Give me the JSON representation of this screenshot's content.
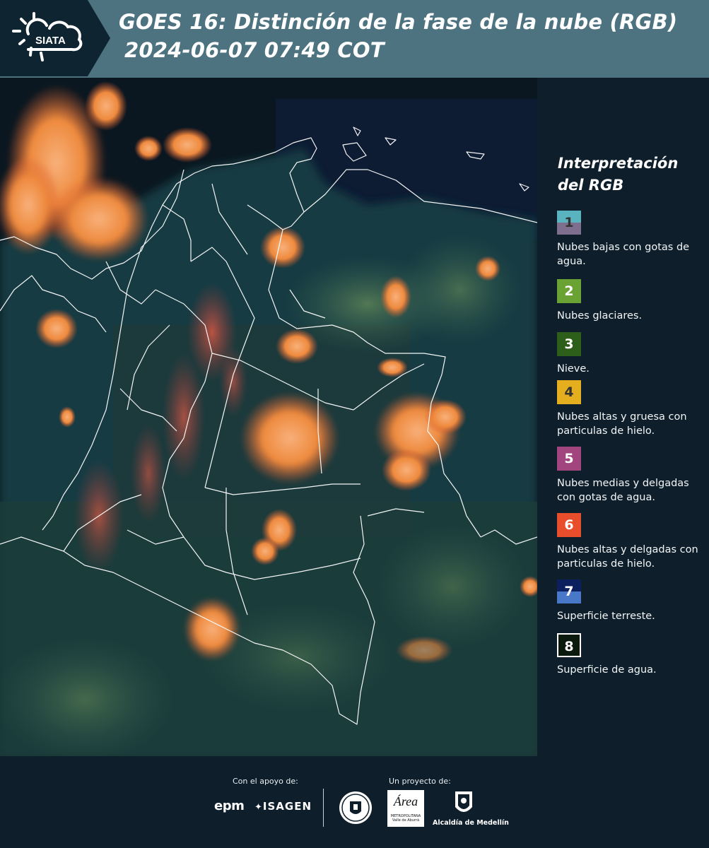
{
  "header": {
    "logo_text": "SIATA",
    "title_line1": "GOES 16: Distinción de la fase de la nube (RGB)",
    "title_line2": "2024-06-07 07:49 COT"
  },
  "legend": {
    "title_line1": "Interpretación",
    "title_line2": "del RGB",
    "items": [
      {
        "num": "1",
        "label": "Nubes bajas con gotas de agua.",
        "color_top": "#5ab4bf",
        "color_bottom": "#7f6f8f",
        "num_color": "#333333"
      },
      {
        "num": "2",
        "label": "Nubes glaciares.",
        "color_top": "#6aa333",
        "color_bottom": "#6aa333",
        "num_color": "#ffffff"
      },
      {
        "num": "3",
        "label": "Nieve.",
        "color_top": "#2e5f1a",
        "color_bottom": "#2e5f1a",
        "num_color": "#ffffff"
      },
      {
        "num": "4",
        "label": "Nubes altas y gruesa con particulas de hielo.",
        "color_top": "#e4ae1e",
        "color_bottom": "#e4ae1e",
        "num_color": "#333333"
      },
      {
        "num": "5",
        "label": "Nubes medias y delgadas con gotas de agua.",
        "color_top": "#a2457e",
        "color_bottom": "#a2457e",
        "num_color": "#ffffff"
      },
      {
        "num": "6",
        "label": "Nubes altas y delgadas con particulas de hielo.",
        "color_top": "#e84e2b",
        "color_bottom": "#e84e2b",
        "num_color": "#ffffff"
      },
      {
        "num": "7",
        "label": "Superficie terreste.",
        "color_top": "#0c2060",
        "color_bottom": "#4a78c8",
        "num_color": "#ffffff"
      },
      {
        "num": "8",
        "label": "Superficie de agua.",
        "color_top": "#0a1a0c",
        "color_bottom": "#0a1a0c",
        "num_color": "#ffffff"
      }
    ]
  },
  "footer": {
    "support_label": "Con el apoyo de:",
    "project_label": "Un proyecto de:",
    "sponsor1": "epm",
    "sponsor2": "ISAGEN",
    "area_name": "Área",
    "area_sub1": "METROPOLITANA",
    "area_sub2": "Valle de Aburrá",
    "alcaldia": "Alcaldía de Medellín"
  },
  "colors": {
    "header_bg": "#4d7280",
    "panel_bg": "#0e1f2b",
    "cloud_orange": "#f28a3a",
    "cloud_red": "#d9503c",
    "land_teal": "#1e4a4a"
  }
}
